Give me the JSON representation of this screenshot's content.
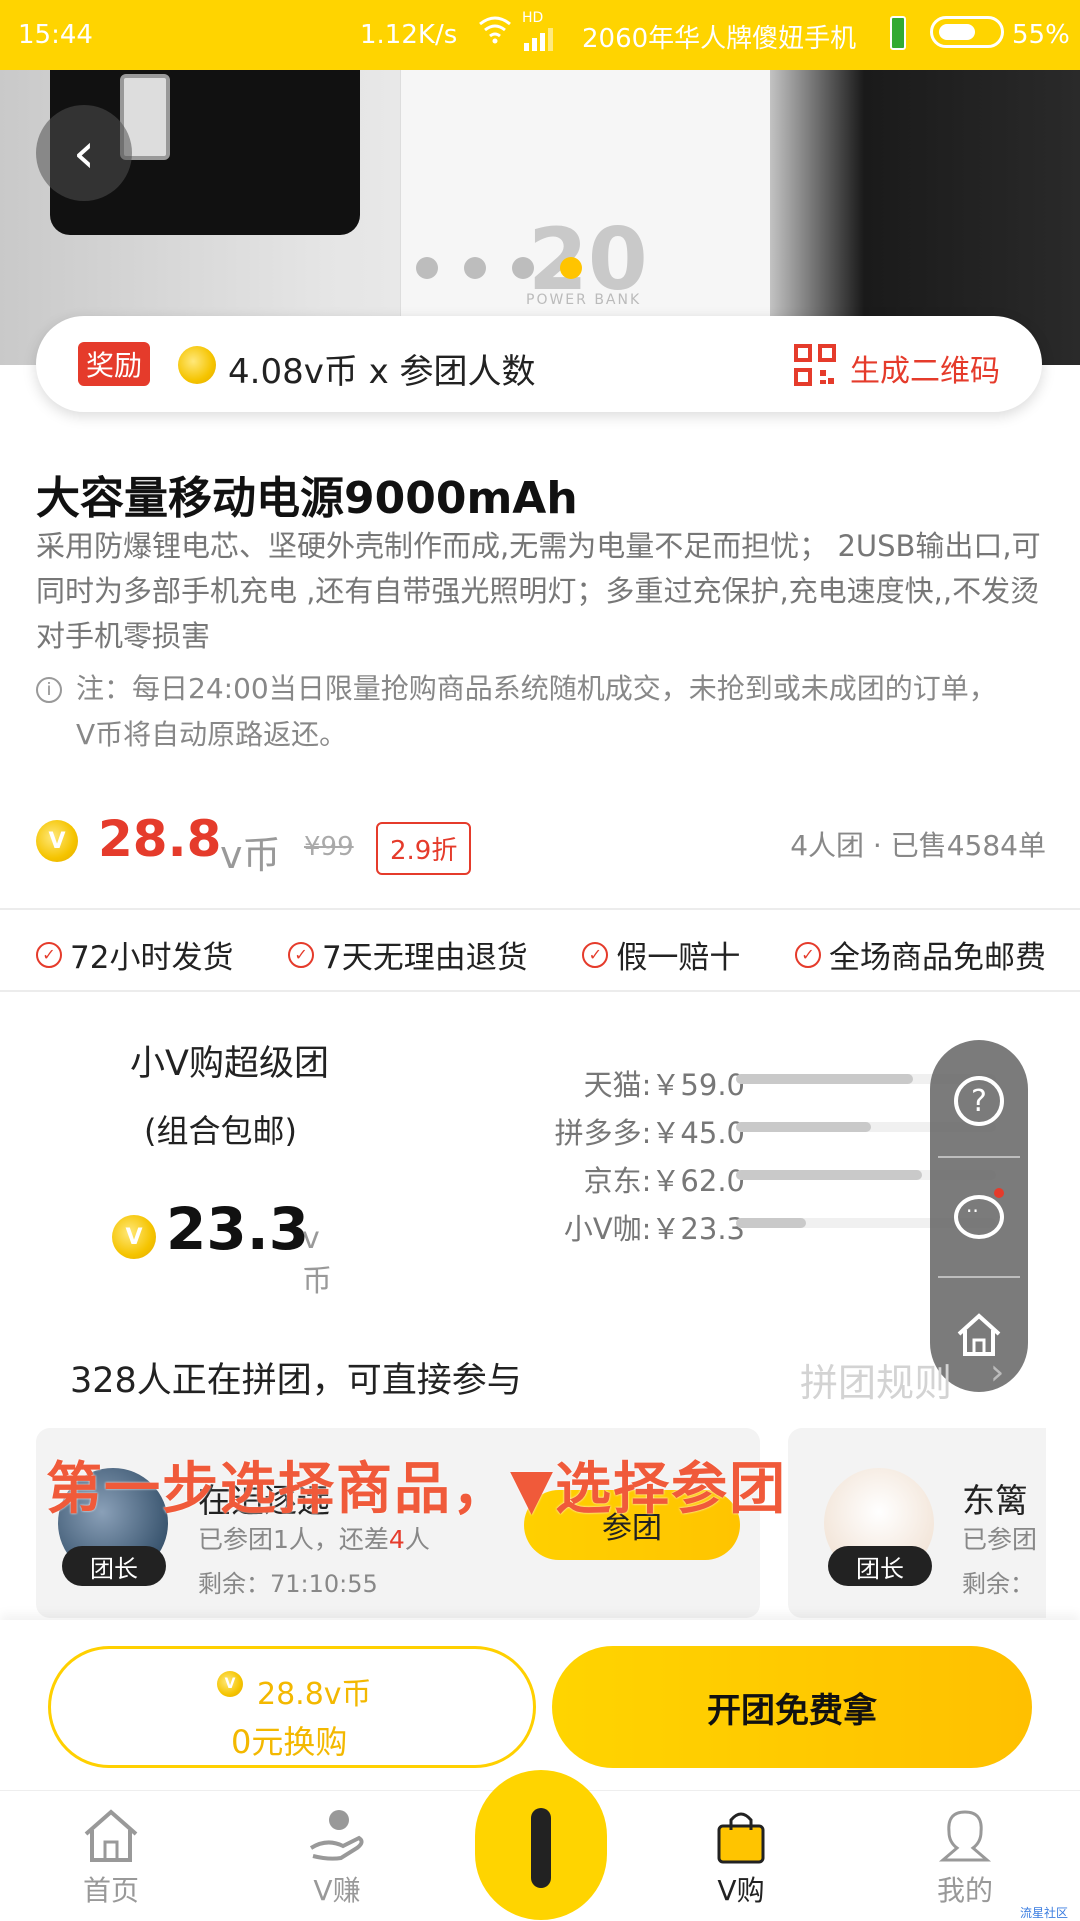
{
  "status_bar": {
    "time": "15:44",
    "speed": "1.12K/s",
    "network": "HD",
    "carrier": "2060年华人牌傻妞手机",
    "battery": "55%"
  },
  "banner": {
    "logo_text": "20",
    "logo_sub": "POWER BANK",
    "slides": 4,
    "active_slide": 4
  },
  "reward": {
    "tag": "奖励",
    "formula": "4.08v币 x 参团人数",
    "qr_label": "生成二维码"
  },
  "product": {
    "title": "大容量移动电源9000mAh",
    "description": "采用防爆锂电芯、坚硬外壳制作而成,无需为电量不足而担忧； 2USB输出口,可同时为多部手机充电 ,还有自带强光照明灯；多重过充保护,充电速度快,,不发烫对手机零损害",
    "note_line1": "注：每日24:00当日限量抢购商品系统随机成交，未抢到或未成团的订单，",
    "note_line2": "V币将自动原路返还。",
    "price": "28.8",
    "price_unit": "v币",
    "original_price": "¥99",
    "discount": "2.9折",
    "sold_info": "4人团 · 已售4584单"
  },
  "guarantees": [
    "72小时发货",
    "7天无理由退货",
    "假一赔十",
    "全场商品免邮费"
  ],
  "group": {
    "name": "小V购超级团",
    "sub": "(组合包邮)",
    "price": "23.3",
    "unit": "v币"
  },
  "comparison": [
    {
      "label": "天猫:￥59.0",
      "value": 59.0
    },
    {
      "label": "拼多多:￥45.0",
      "value": 45.0
    },
    {
      "label": "京东:￥62.0",
      "value": 62.0
    },
    {
      "label": "小V咖:￥23.3",
      "value": 23.3
    }
  ],
  "participation": {
    "text": "328人正在拼团，可直接参与",
    "rules": "拼团规则"
  },
  "cards": [
    {
      "name": "在追逐远",
      "status_prefix": "已参团1人，还差",
      "status_count": "4",
      "status_suffix": "人",
      "remaining": "剩余：71:10:55",
      "leader": "团长",
      "join": "参团"
    },
    {
      "name": "东篱",
      "status": "已参团",
      "remaining": "剩余：",
      "leader": "团长"
    }
  ],
  "overlay_instruction": "第一步选择商品，▼选择参团",
  "actions": {
    "exchange_price": "28.8v币",
    "exchange_label": "0元换购",
    "open_group": "开团免费拿"
  },
  "tabs": [
    {
      "label": "首页",
      "icon": "home-icon"
    },
    {
      "label": "V赚",
      "icon": "hand-icon"
    },
    {
      "label": "V购",
      "icon": "bag-icon",
      "active": true
    },
    {
      "label": "我的",
      "icon": "user-icon"
    }
  ],
  "watermark": "流星社区",
  "colors": {
    "accent": "#ffd400",
    "red": "#e53b2b",
    "gray": "#888888"
  }
}
